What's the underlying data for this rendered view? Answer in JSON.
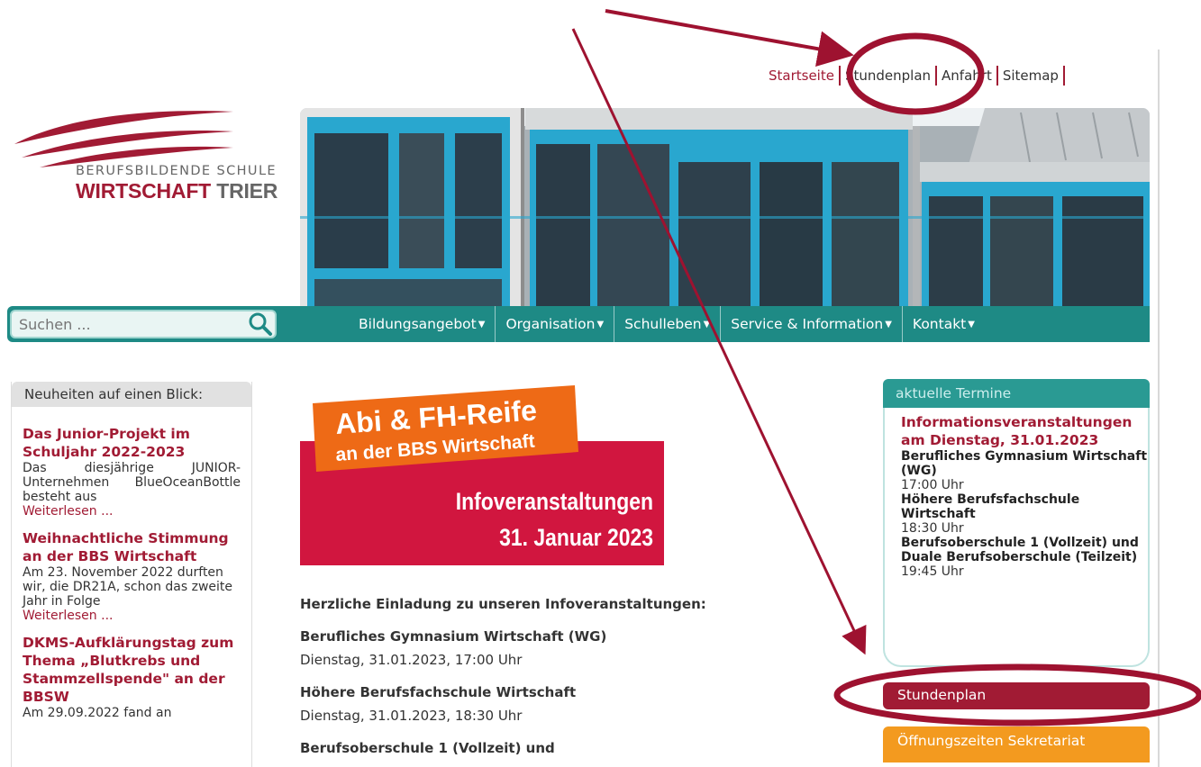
{
  "top_links": [
    "Startseite",
    "Stundenplan",
    "Anfahrt",
    "Sitemap"
  ],
  "logo": {
    "line1": "BERUFSBILDENDE SCHULE",
    "line2a": "WIRTSCHAFT",
    "line2b": " TRIER"
  },
  "search": {
    "placeholder": "Suchen ..."
  },
  "menu": [
    "Bildungsangebot",
    "Organisation",
    "Schulleben",
    "Service & Information",
    "Kontakt"
  ],
  "news": {
    "heading": "Neuheiten auf einen Blick:",
    "items": [
      {
        "title": "Das Junior-Projekt im Schuljahr 2022-2023",
        "text": "Das diesjährige JUNIOR-Unternehmen BlueOceanBottle besteht aus",
        "more": "Weiterlesen ..."
      },
      {
        "title": "Weihnachtliche Stimmung an der BBS Wirtschaft",
        "text": "Am 23. November 2022 durften wir, die DR21A, schon das zweite Jahr in Folge",
        "more": "Weiterlesen ..."
      },
      {
        "title": "DKMS-Aufklärungstag zum Thema „Blutkrebs und Stammzellspende\" an der BBSW",
        "text": "Am 29.09.2022 fand an",
        "more": ""
      }
    ]
  },
  "promo": {
    "line1": "Abi & FH-Reife",
    "line2": "an der BBS Wirtschaft",
    "line3": "Infoveranstaltungen",
    "line4": "31. Januar 2023"
  },
  "center": {
    "intro": "Herzliche Einladung zu unseren Infoveranstaltungen:",
    "events": [
      {
        "title": "Berufliches Gymnasium Wirtschaft (WG)",
        "date": "Dienstag, 31.01.2023, 17:00 Uhr"
      },
      {
        "title": "Höhere Berufsfachschule Wirtschaft",
        "date": "Dienstag, 31.01.2023, 18:30 Uhr"
      },
      {
        "title": "Berufsoberschule 1 (Vollzeit) und",
        "date": ""
      }
    ]
  },
  "termine": {
    "heading": "aktuelle Termine",
    "title": "Informationsveranstaltungen am Dienstag, 31.01.2023",
    "entries": [
      {
        "school": "Berufliches Gymnasium Wirtschaft (WG)",
        "time": "17:00 Uhr"
      },
      {
        "school": "Höhere Berufsfachschule Wirtschaft",
        "time": "18:30 Uhr"
      },
      {
        "school": "Berufsoberschule 1 (Vollzeit) und Duale Berufsoberschule (Teilzeit)",
        "time": "19:45 Uhr"
      }
    ]
  },
  "buttons": {
    "stundenplan": "Stundenplan",
    "oeffnungszeiten": "Öffnungszeiten Sekretariat"
  },
  "colors": {
    "brand_red": "#a11b34",
    "nav_teal": "#1e8a85",
    "termine_teal": "#2a9a93",
    "orange": "#f39a1f",
    "annotation": "#9e1230"
  }
}
